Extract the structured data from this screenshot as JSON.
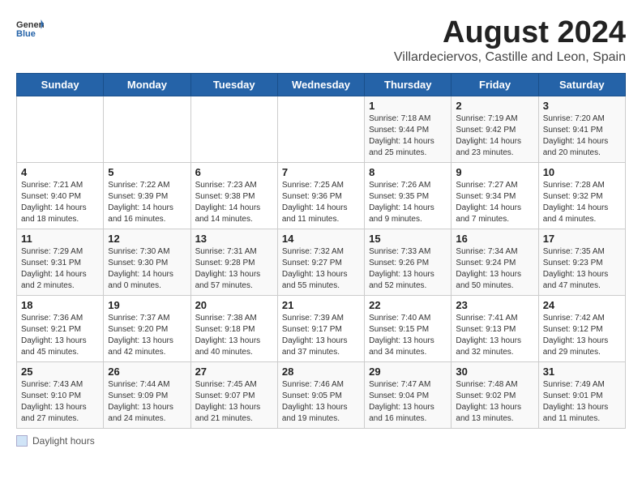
{
  "logo": {
    "general": "General",
    "blue": "Blue"
  },
  "title": "August 2024",
  "subtitle": "Villardeciervos, Castille and Leon, Spain",
  "headers": [
    "Sunday",
    "Monday",
    "Tuesday",
    "Wednesday",
    "Thursday",
    "Friday",
    "Saturday"
  ],
  "weeks": [
    [
      {
        "day": "",
        "info": ""
      },
      {
        "day": "",
        "info": ""
      },
      {
        "day": "",
        "info": ""
      },
      {
        "day": "",
        "info": ""
      },
      {
        "day": "1",
        "info": "Sunrise: 7:18 AM\nSunset: 9:44 PM\nDaylight: 14 hours and 25 minutes."
      },
      {
        "day": "2",
        "info": "Sunrise: 7:19 AM\nSunset: 9:42 PM\nDaylight: 14 hours and 23 minutes."
      },
      {
        "day": "3",
        "info": "Sunrise: 7:20 AM\nSunset: 9:41 PM\nDaylight: 14 hours and 20 minutes."
      }
    ],
    [
      {
        "day": "4",
        "info": "Sunrise: 7:21 AM\nSunset: 9:40 PM\nDaylight: 14 hours and 18 minutes."
      },
      {
        "day": "5",
        "info": "Sunrise: 7:22 AM\nSunset: 9:39 PM\nDaylight: 14 hours and 16 minutes."
      },
      {
        "day": "6",
        "info": "Sunrise: 7:23 AM\nSunset: 9:38 PM\nDaylight: 14 hours and 14 minutes."
      },
      {
        "day": "7",
        "info": "Sunrise: 7:25 AM\nSunset: 9:36 PM\nDaylight: 14 hours and 11 minutes."
      },
      {
        "day": "8",
        "info": "Sunrise: 7:26 AM\nSunset: 9:35 PM\nDaylight: 14 hours and 9 minutes."
      },
      {
        "day": "9",
        "info": "Sunrise: 7:27 AM\nSunset: 9:34 PM\nDaylight: 14 hours and 7 minutes."
      },
      {
        "day": "10",
        "info": "Sunrise: 7:28 AM\nSunset: 9:32 PM\nDaylight: 14 hours and 4 minutes."
      }
    ],
    [
      {
        "day": "11",
        "info": "Sunrise: 7:29 AM\nSunset: 9:31 PM\nDaylight: 14 hours and 2 minutes."
      },
      {
        "day": "12",
        "info": "Sunrise: 7:30 AM\nSunset: 9:30 PM\nDaylight: 14 hours and 0 minutes."
      },
      {
        "day": "13",
        "info": "Sunrise: 7:31 AM\nSunset: 9:28 PM\nDaylight: 13 hours and 57 minutes."
      },
      {
        "day": "14",
        "info": "Sunrise: 7:32 AM\nSunset: 9:27 PM\nDaylight: 13 hours and 55 minutes."
      },
      {
        "day": "15",
        "info": "Sunrise: 7:33 AM\nSunset: 9:26 PM\nDaylight: 13 hours and 52 minutes."
      },
      {
        "day": "16",
        "info": "Sunrise: 7:34 AM\nSunset: 9:24 PM\nDaylight: 13 hours and 50 minutes."
      },
      {
        "day": "17",
        "info": "Sunrise: 7:35 AM\nSunset: 9:23 PM\nDaylight: 13 hours and 47 minutes."
      }
    ],
    [
      {
        "day": "18",
        "info": "Sunrise: 7:36 AM\nSunset: 9:21 PM\nDaylight: 13 hours and 45 minutes."
      },
      {
        "day": "19",
        "info": "Sunrise: 7:37 AM\nSunset: 9:20 PM\nDaylight: 13 hours and 42 minutes."
      },
      {
        "day": "20",
        "info": "Sunrise: 7:38 AM\nSunset: 9:18 PM\nDaylight: 13 hours and 40 minutes."
      },
      {
        "day": "21",
        "info": "Sunrise: 7:39 AM\nSunset: 9:17 PM\nDaylight: 13 hours and 37 minutes."
      },
      {
        "day": "22",
        "info": "Sunrise: 7:40 AM\nSunset: 9:15 PM\nDaylight: 13 hours and 34 minutes."
      },
      {
        "day": "23",
        "info": "Sunrise: 7:41 AM\nSunset: 9:13 PM\nDaylight: 13 hours and 32 minutes."
      },
      {
        "day": "24",
        "info": "Sunrise: 7:42 AM\nSunset: 9:12 PM\nDaylight: 13 hours and 29 minutes."
      }
    ],
    [
      {
        "day": "25",
        "info": "Sunrise: 7:43 AM\nSunset: 9:10 PM\nDaylight: 13 hours and 27 minutes."
      },
      {
        "day": "26",
        "info": "Sunrise: 7:44 AM\nSunset: 9:09 PM\nDaylight: 13 hours and 24 minutes."
      },
      {
        "day": "27",
        "info": "Sunrise: 7:45 AM\nSunset: 9:07 PM\nDaylight: 13 hours and 21 minutes."
      },
      {
        "day": "28",
        "info": "Sunrise: 7:46 AM\nSunset: 9:05 PM\nDaylight: 13 hours and 19 minutes."
      },
      {
        "day": "29",
        "info": "Sunrise: 7:47 AM\nSunset: 9:04 PM\nDaylight: 13 hours and 16 minutes."
      },
      {
        "day": "30",
        "info": "Sunrise: 7:48 AM\nSunset: 9:02 PM\nDaylight: 13 hours and 13 minutes."
      },
      {
        "day": "31",
        "info": "Sunrise: 7:49 AM\nSunset: 9:01 PM\nDaylight: 13 hours and 11 minutes."
      }
    ]
  ],
  "footer": {
    "box_label": "Daylight hours"
  }
}
